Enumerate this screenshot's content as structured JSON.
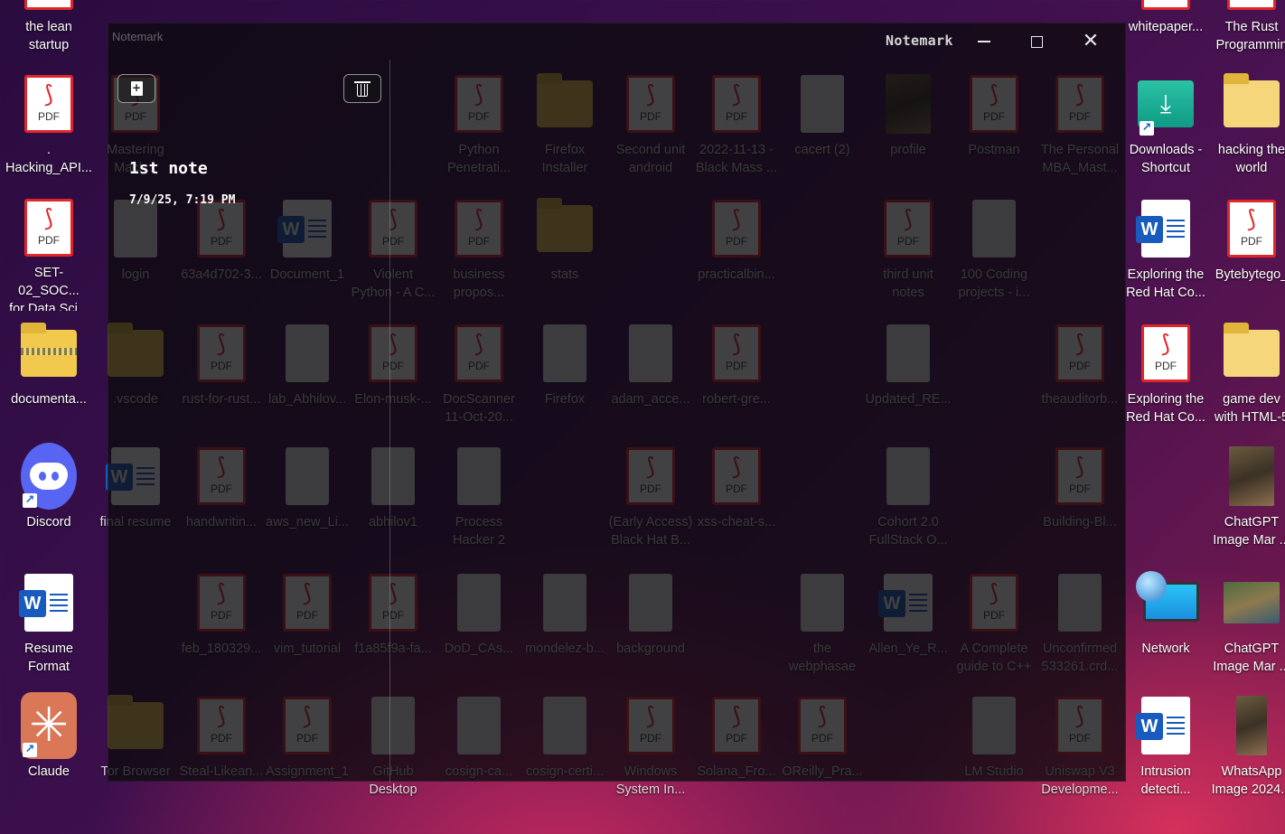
{
  "desktop": {
    "left_column": [
      {
        "label": "the lean\nstartup",
        "type": "pdf"
      },
      {
        "label": ". Hacking_API...",
        "type": "pdf"
      },
      {
        "label": "SET-02_SOC...\nfor Data Sci...",
        "type": "pdf"
      },
      {
        "label": "documenta...",
        "type": "zip"
      },
      {
        "label": "Discord",
        "type": "discord"
      },
      {
        "label": "Resume\nFormat",
        "type": "word"
      },
      {
        "label": "Claude",
        "type": "claude"
      }
    ],
    "right_column_a": [
      {
        "label": "whitepaper...",
        "type": "pdf"
      },
      {
        "label": "Downloads -\nShortcut",
        "type": "downloads"
      },
      {
        "label": "Exploring the\nRed Hat Co...",
        "type": "word"
      },
      {
        "label": "Exploring the\nRed Hat Co...",
        "type": "pdf"
      },
      {
        "label": "",
        "type": "none"
      },
      {
        "label": "Network",
        "type": "network"
      },
      {
        "label": "Intrusion\ndetecti...",
        "type": "word"
      }
    ],
    "right_column_b": [
      {
        "label": "The Rust\nProgrammin",
        "type": "pdf"
      },
      {
        "label": "hacking the\nworld",
        "type": "folder"
      },
      {
        "label": "Bytebytego_",
        "type": "pdf"
      },
      {
        "label": "game dev\nwith HTML-5",
        "type": "folder"
      },
      {
        "label": "ChatGPT\nImage Mar ...",
        "type": "photo"
      },
      {
        "label": "ChatGPT\nImage Mar ...",
        "type": "photo-wide"
      },
      {
        "label": "WhatsApp\nImage 2024...",
        "type": "photo"
      }
    ],
    "behind_window": [
      {
        "label": "Mastering\nMach...",
        "type": "pdf"
      },
      {
        "label": "Python\nPenetrati...",
        "type": "pdf"
      },
      {
        "label": "Firefox\nInstaller",
        "type": "folder"
      },
      {
        "label": "Second unit\nandroid",
        "type": "pdf"
      },
      {
        "label": "2022-11-13 -\nBlack Mass ...",
        "type": "pdf"
      },
      {
        "label": "cacert (2)",
        "type": "doc"
      },
      {
        "label": "profile",
        "type": "photo"
      },
      {
        "label": "Postman",
        "type": "pdf"
      },
      {
        "label": "The Personal\nMBA_Mast...",
        "type": "pdf"
      },
      {
        "label": "login",
        "type": "doc"
      },
      {
        "label": "63a4d702-3...",
        "type": "pdf"
      },
      {
        "label": "Document_1",
        "type": "word"
      },
      {
        "label": "Violent\nPython - A C...",
        "type": "pdf"
      },
      {
        "label": "business\npropos...",
        "type": "pdf"
      },
      {
        "label": "stats",
        "type": "folder"
      },
      {
        "label": "practicalbin...",
        "type": "pdf"
      },
      {
        "label": "third unit\nnotes",
        "type": "pdf"
      },
      {
        "label": "100 Coding\nprojects - i...",
        "type": "doc"
      },
      {
        "label": ".vscode",
        "type": "folder"
      },
      {
        "label": "rust-for-rust...",
        "type": "pdf"
      },
      {
        "label": "lab_Abhilov...",
        "type": "doc"
      },
      {
        "label": "Elon-musk-...",
        "type": "pdf"
      },
      {
        "label": "DocScanner\n11-Oct-20...",
        "type": "pdf"
      },
      {
        "label": "Firefox",
        "type": "doc"
      },
      {
        "label": "adam_acce...",
        "type": "doc"
      },
      {
        "label": "robert-gre...",
        "type": "pdf"
      },
      {
        "label": "Updated_RE...",
        "type": "doc"
      },
      {
        "label": "theauditorb...",
        "type": "pdf"
      },
      {
        "label": "final resume",
        "type": "word"
      },
      {
        "label": "handwritin...",
        "type": "pdf"
      },
      {
        "label": "aws_new_Li...",
        "type": "doc"
      },
      {
        "label": "abhilov1",
        "type": "doc"
      },
      {
        "label": "Process\nHacker 2",
        "type": "doc"
      },
      {
        "label": "(Early Access)\nBlack Hat B...",
        "type": "pdf"
      },
      {
        "label": "xss-cheat-s...",
        "type": "pdf"
      },
      {
        "label": "Cohort 2.0\nFullStack O...",
        "type": "doc"
      },
      {
        "label": "Building-Bl...",
        "type": "pdf"
      },
      {
        "label": "feb_180329...",
        "type": "pdf"
      },
      {
        "label": "vim_tutorial",
        "type": "pdf"
      },
      {
        "label": "f1a85f9a-fa...",
        "type": "pdf"
      },
      {
        "label": "DoD_CAs...",
        "type": "doc"
      },
      {
        "label": "mondelez-b...",
        "type": "doc"
      },
      {
        "label": "background",
        "type": "doc"
      },
      {
        "label": "the\nwebphasae",
        "type": "doc"
      },
      {
        "label": "Allen_Ye_R...",
        "type": "word"
      },
      {
        "label": "A Complete\nguide to C++",
        "type": "pdf"
      },
      {
        "label": "Unconfirmed\n533261.crd...",
        "type": "doc"
      },
      {
        "label": "Tor Browser",
        "type": "folder"
      },
      {
        "label": "Steal-Likean...",
        "type": "pdf"
      },
      {
        "label": "Assignment_1",
        "type": "pdf"
      },
      {
        "label": "GitHub\nDesktop",
        "type": "doc"
      },
      {
        "label": "cosign-ca...",
        "type": "doc"
      },
      {
        "label": "cosign-certi...",
        "type": "doc"
      },
      {
        "label": "Windows\nSystem In...",
        "type": "pdf"
      },
      {
        "label": "Solana_Fro...",
        "type": "pdf"
      },
      {
        "label": "OReilly_Pra...",
        "type": "pdf"
      },
      {
        "label": "LM Studio",
        "type": "doc"
      },
      {
        "label": "Uniswap V3\nDevelopme...",
        "type": "pdf"
      }
    ]
  },
  "window": {
    "ghost_title": "Notemark",
    "title": "Notemark",
    "notes": [
      {
        "title": "1st note",
        "date": "7/9/25, 7:19 PM"
      }
    ]
  },
  "icons": {
    "pdf_text": "PDF",
    "word_letter": "W",
    "claude_glyph": "✳"
  },
  "colors": {
    "pdf_red": "#e1262a",
    "word_blue": "#185abd",
    "discord": "#5865f2",
    "claude": "#d97757"
  }
}
